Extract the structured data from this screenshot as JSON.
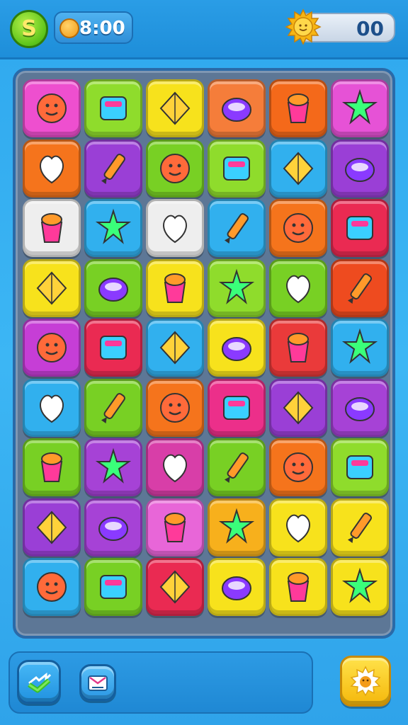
{
  "header": {
    "coin_symbol": "S",
    "timer": "8:00",
    "score": "00"
  },
  "board": {
    "columns": 6,
    "rows": 9,
    "tiles": [
      {
        "color": "#ee4fcf",
        "icon": "girl-face-icon"
      },
      {
        "color": "#8fdc2c",
        "icon": "kite-icon"
      },
      {
        "color": "#f7e21c",
        "icon": "purse-icon"
      },
      {
        "color": "#f57d3a",
        "icon": "planet-icon"
      },
      {
        "color": "#f4691a",
        "icon": "ice-cream-cup-icon"
      },
      {
        "color": "#e652d6",
        "icon": "flower-donut-icon"
      },
      {
        "color": "#f5741c",
        "icon": "green-box-icon"
      },
      {
        "color": "#9a3fd6",
        "icon": "parrot-icon"
      },
      {
        "color": "#78d024",
        "icon": "boy-cap-icon"
      },
      {
        "color": "#8fdc2c",
        "icon": "curly-kid-icon"
      },
      {
        "color": "#31b0ee",
        "icon": "bird-icon"
      },
      {
        "color": "#9a3fd6",
        "icon": "juice-bottle-icon"
      },
      {
        "color": "#eeeeee",
        "icon": "cake-slice-icon"
      },
      {
        "color": "#31b0ee",
        "icon": "red-cube-icon"
      },
      {
        "color": "#eeeeee",
        "icon": "cracker-icon"
      },
      {
        "color": "#31b0ee",
        "icon": "purple-bag-icon"
      },
      {
        "color": "#f5741c",
        "icon": "play-box-icon"
      },
      {
        "color": "#ea2a52",
        "icon": "blue-egg-icon"
      },
      {
        "color": "#f7e21c",
        "icon": "berry-jar-icon"
      },
      {
        "color": "#78d024",
        "icon": "teddy-bear-icon"
      },
      {
        "color": "#f7e21c",
        "icon": "magic-wand-icon"
      },
      {
        "color": "#8fdc2c",
        "icon": "lollipop-icon"
      },
      {
        "color": "#78d024",
        "icon": "strawberry-icon"
      },
      {
        "color": "#ee4b1f",
        "icon": "red-roll-icon"
      },
      {
        "color": "#c63ed6",
        "icon": "striped-egg-icon"
      },
      {
        "color": "#ea2a52",
        "icon": "gift-box-icon"
      },
      {
        "color": "#31b0ee",
        "icon": "blue-star-icon"
      },
      {
        "color": "#f7e21c",
        "icon": "envelope-icon"
      },
      {
        "color": "#ea3a3a",
        "icon": "toaster-icon"
      },
      {
        "color": "#31b0ee",
        "icon": "crate-icon"
      },
      {
        "color": "#31b0ee",
        "icon": "yellow-monster-icon"
      },
      {
        "color": "#78d024",
        "icon": "shell-icon"
      },
      {
        "color": "#f5741c",
        "icon": "orange-star-icon"
      },
      {
        "color": "#ec2f8a",
        "icon": "pencil-icon"
      },
      {
        "color": "#9a3fd6",
        "icon": "blue-leaf-icon"
      },
      {
        "color": "#a642d6",
        "icon": "pancakes-icon"
      },
      {
        "color": "#78d024",
        "icon": "bread-loaf-icon"
      },
      {
        "color": "#a642d6",
        "icon": "cupcake-icon"
      },
      {
        "color": "#d83ea8",
        "icon": "apple-icon"
      },
      {
        "color": "#78d024",
        "icon": "milk-carton-icon"
      },
      {
        "color": "#f5741c",
        "icon": "bowl-icon"
      },
      {
        "color": "#8fdc2c",
        "icon": "chat-bubble-icon"
      },
      {
        "color": "#9a3fd6",
        "icon": "orange-fruit-icon"
      },
      {
        "color": "#a642d6",
        "icon": "blue-drop-icon"
      },
      {
        "color": "#e866d8",
        "icon": "green-pencil-icon"
      },
      {
        "color": "#f7b01c",
        "icon": "candy-icon"
      },
      {
        "color": "#f7e21c",
        "icon": "radish-icon"
      },
      {
        "color": "#f7e21c",
        "icon": "elf-kid-icon"
      },
      {
        "color": "#31b0ee",
        "icon": "marker-icon"
      },
      {
        "color": "#78d024",
        "icon": "boy-face-icon"
      },
      {
        "color": "#ea2a52",
        "icon": "potion-icon"
      },
      {
        "color": "#f7e21c",
        "icon": "ice-cream-cone-icon"
      },
      {
        "color": "#f7e21c",
        "icon": "grape-bunch-icon"
      },
      {
        "color": "#f7e21c",
        "icon": "bowl-blue-icon"
      }
    ]
  },
  "footer": {
    "shuffle": "shuffle-arrows-icon",
    "hint": "hint-ticket-icon",
    "power": "sun-power-icon"
  }
}
